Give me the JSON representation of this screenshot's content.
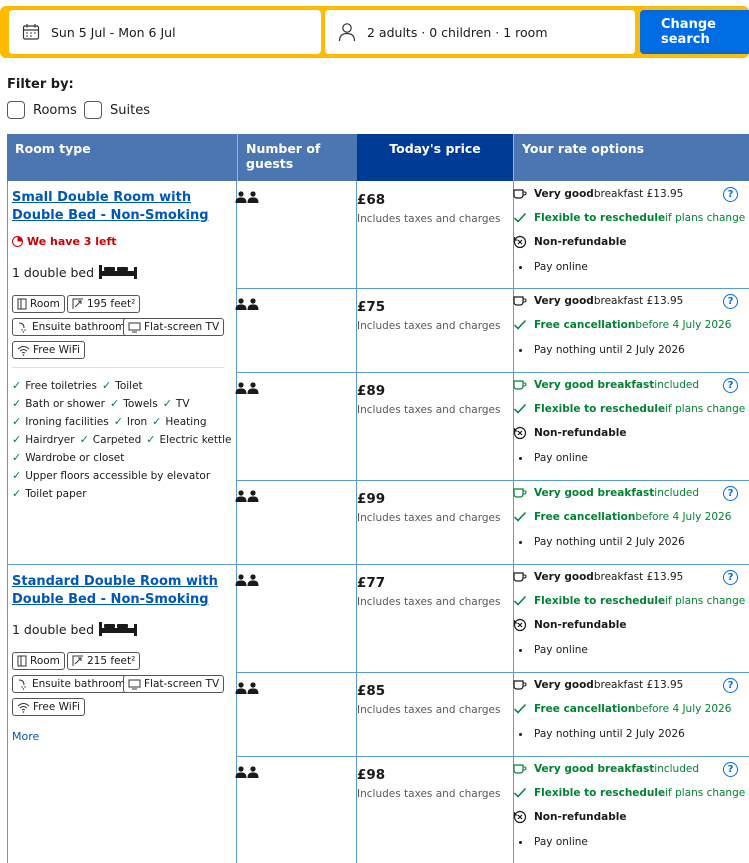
{
  "search": {
    "dates": "Sun 5 Jul - Mon 6 Jul",
    "guests": "2 adults · 0 children · 1 room",
    "button": "Change search"
  },
  "filters": {
    "title": "Filter by:",
    "options": [
      "Rooms",
      "Suites"
    ]
  },
  "table": {
    "headers": {
      "room_type": "Room type",
      "guests": "Number of guests",
      "price": "Today's price",
      "rate": "Your rate options"
    }
  },
  "rooms": [
    {
      "name_line1": "Small Double Room with",
      "name_line2": "Double Bed - Non-Smoking",
      "availability": "We have 3 left",
      "bed": "1 double bed",
      "chips": [
        "Room",
        "195 feet²",
        "Ensuite bathroom",
        "Flat-screen TV",
        "Free WiFi"
      ],
      "amenities": [
        [
          "Free toiletries",
          "Toilet"
        ],
        [
          "Bath or shower",
          "Towels",
          "TV"
        ],
        [
          "Ironing facilities",
          "Iron",
          "Heating"
        ],
        [
          "Hairdryer",
          "Carpeted",
          "Electric kettle"
        ],
        [
          "Wardrobe or closet"
        ],
        [
          "Upper floors accessible by elevator"
        ],
        [
          "Toilet paper"
        ]
      ]
    },
    {
      "name_line1": "Standard Double Room with",
      "name_line2": "Double Bed - Non-Smoking",
      "bed": "1 double bed",
      "chips": [
        "Room",
        "215 feet²",
        "Ensuite bathroom",
        "Flat-screen TV",
        "Free WiFi"
      ],
      "more": "More"
    }
  ],
  "rates": [
    {
      "price": "£68",
      "sub": "Includes taxes and charges",
      "l1b": "Very good",
      "l1": " breakfast £13.95",
      "l2b": "Flexible to reschedule",
      "l2": " if plans change",
      "l3b": "Non-refundable",
      "l4": "Pay online"
    },
    {
      "price": "£75",
      "sub": "Includes taxes and charges",
      "l1b": "Very good",
      "l1": " breakfast £13.95",
      "l2b": "Free cancellation",
      "l2": " before 4 July 2026",
      "l3": "Pay nothing until 2 July 2026"
    },
    {
      "price": "£89",
      "sub": "Includes taxes and charges",
      "l1b": "Very good breakfast",
      "l1": " included",
      "l2b": "Flexible to reschedule",
      "l2": " if plans change",
      "l3b": "Non-refundable",
      "l4": "Pay online"
    },
    {
      "price": "£99",
      "sub": "Includes taxes and charges",
      "l1b": "Very good breakfast",
      "l1": " included",
      "l2b": "Free cancellation",
      "l2": " before 4 July 2026",
      "l3": "Pay nothing until 2 July 2026"
    },
    {
      "price": "£77",
      "sub": "Includes taxes and charges",
      "l1b": "Very good",
      "l1": " breakfast £13.95",
      "l2b": "Flexible to reschedule",
      "l2": " if plans change",
      "l3b": "Non-refundable",
      "l4": "Pay online"
    },
    {
      "price": "£85",
      "sub": "Includes taxes and charges",
      "l1b": "Very good",
      "l1": " breakfast £13.95",
      "l2b": "Free cancellation",
      "l2": " before 4 July 2026",
      "l3": "Pay nothing until 2 July 2026"
    },
    {
      "price": "£98",
      "sub": "Includes taxes and charges",
      "l1b": "Very good breakfast",
      "l1": " included",
      "l2b": "Flexible to reschedule",
      "l2": " if plans change",
      "l3b": "Non-refundable",
      "l4": "Pay online"
    }
  ],
  "help_glyph": "?",
  "colors": {
    "brand_blue": "#006ce4",
    "search_yellow": "#febb02",
    "header_blue": "#4c76b2",
    "price_header": "#003b95",
    "green": "#008234",
    "red": "#cc0000"
  }
}
